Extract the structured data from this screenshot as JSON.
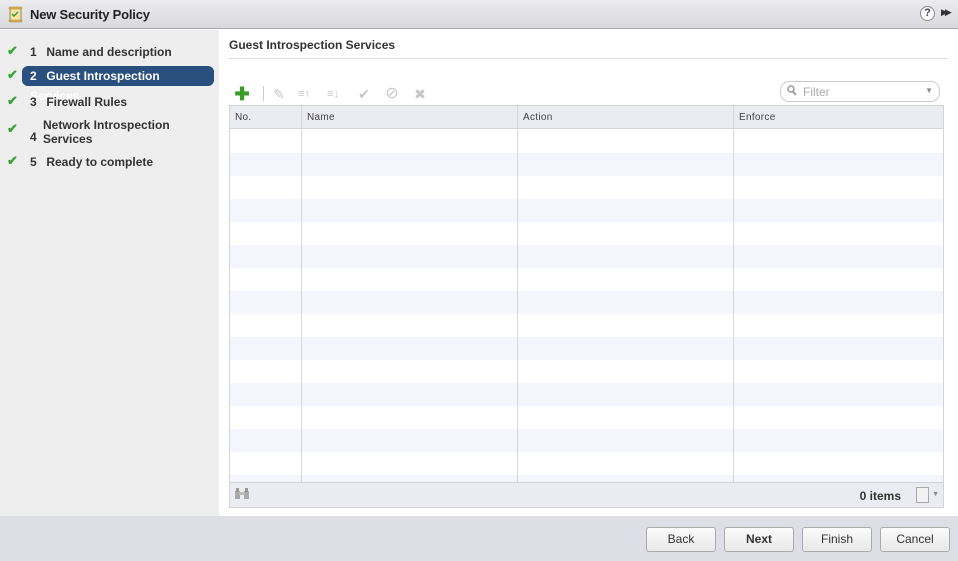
{
  "window": {
    "title": "New Security Policy",
    "help_label": "?",
    "expand_label": "▶▶"
  },
  "wizard": {
    "steps": [
      {
        "num": "1",
        "label": "Name and description",
        "completed": true,
        "active": false
      },
      {
        "num": "2",
        "label": "Guest Introspection Services",
        "completed": true,
        "active": true
      },
      {
        "num": "3",
        "label": "Firewall Rules",
        "completed": true,
        "active": false
      },
      {
        "num": "4",
        "label": "Network Introspection Services",
        "completed": true,
        "active": false
      },
      {
        "num": "5",
        "label": "Ready to complete",
        "completed": true,
        "active": false
      }
    ],
    "check_glyph": "✔"
  },
  "section": {
    "title": "Guest Introspection Services"
  },
  "toolbar": {
    "add_glyph": "✚",
    "edit_glyph": "✎",
    "move_up_glyph": "≡↑",
    "move_down_glyph": "≡↓",
    "enable_glyph": "✔",
    "disable_glyph": "⊘",
    "delete_glyph": "✖"
  },
  "filter": {
    "placeholder": "Filter",
    "value": "",
    "search_glyph": "🔍",
    "caret_glyph": "▼"
  },
  "grid": {
    "columns": [
      "No.",
      "Name",
      "Action",
      "Enforce"
    ],
    "rows": [],
    "item_count": "0 items",
    "find_glyph": "👁",
    "export_caret": "▼"
  },
  "buttons": {
    "back": "Back",
    "next": "Next",
    "finish": "Finish",
    "cancel": "Cancel"
  }
}
